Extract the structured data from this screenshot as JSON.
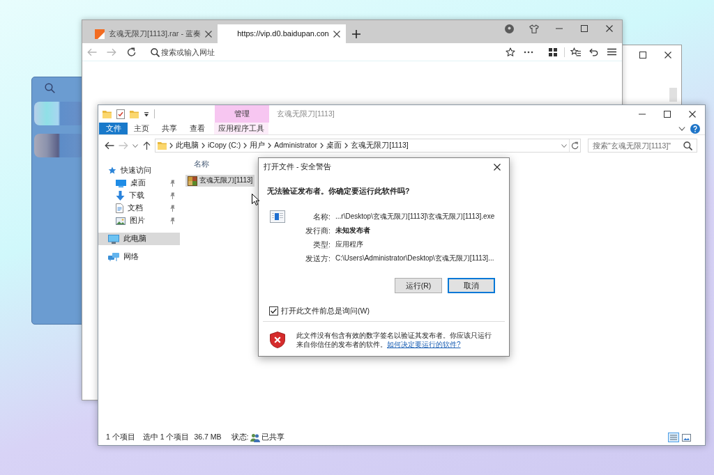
{
  "browser": {
    "tabs": [
      {
        "title": "玄魂无限刀[1113].rar - 蓝奏",
        "favicon": true,
        "selected": false
      },
      {
        "title": "https://vip.d0.baidupan.con",
        "favicon": false,
        "selected": true
      }
    ],
    "address_bar": {
      "placeholder": "搜索或输入网址"
    }
  },
  "explorer": {
    "context_group": "管理",
    "title": "玄魂无限刀[1113]",
    "ribbon_tabs": [
      {
        "label": "文件",
        "kind": "file"
      },
      {
        "label": "主页",
        "kind": "tab"
      },
      {
        "label": "共享",
        "kind": "tab"
      },
      {
        "label": "查看",
        "kind": "tab"
      },
      {
        "label": "应用程序工具",
        "kind": "context"
      }
    ],
    "breadcrumbs": [
      "此电脑",
      "iCopy (C:)",
      "用户",
      "Administrator",
      "桌面",
      "玄魂无限刀[1113]"
    ],
    "search": {
      "placeholder": "搜索\"玄魂无限刀[1113]\""
    },
    "navigation": [
      {
        "label": "快速访问",
        "kind": "quick-access",
        "selected": false,
        "children": [
          {
            "label": "桌面",
            "kind": "desktop",
            "pinned": true,
            "selected": false
          },
          {
            "label": "下载",
            "kind": "downloads",
            "pinned": true,
            "selected": false
          },
          {
            "label": "文档",
            "kind": "documents",
            "pinned": true,
            "selected": false
          },
          {
            "label": "图片",
            "kind": "pictures",
            "pinned": true,
            "selected": false
          }
        ]
      },
      {
        "label": "此电脑",
        "kind": "pc",
        "selected": true
      },
      {
        "label": "网络",
        "kind": "network",
        "selected": false
      }
    ],
    "columns": [
      "名称"
    ],
    "files": [
      {
        "name": "玄魂无限刀[1113]",
        "selected": true
      }
    ],
    "status_bar": {
      "item_count": "1 个项目",
      "selection": "选中 1 个项目",
      "size": "36.7 MB",
      "state_label": "状态:",
      "state": "已共享"
    }
  },
  "dialog": {
    "title": "打开文件 - 安全警告",
    "question": "无法验证发布者。你确定要运行此软件吗?",
    "fields": [
      {
        "label": "名称:",
        "value": "...r\\Desktop\\玄魂无限刀[1113]\\玄魂无限刀[1113].exe",
        "bold": false
      },
      {
        "label": "发行商:",
        "value": "未知发布者",
        "bold": true
      },
      {
        "label": "类型:",
        "value": "应用程序",
        "bold": false
      },
      {
        "label": "发送方:",
        "value": "C:\\Users\\Administrator\\Desktop\\玄魂无限刀[1113]...",
        "bold": false
      }
    ],
    "buttons": [
      {
        "label": "运行(R)",
        "focused": false
      },
      {
        "label": "取消",
        "focused": true
      }
    ],
    "always_ask": {
      "label": "打开此文件前总是询问(W)",
      "checked": true
    },
    "warning": {
      "text": "此文件没有包含有效的数字签名以验证其发布者。你应该只运行来自你信任的发布者的软件。",
      "link": "如何决定要运行的软件?"
    }
  }
}
